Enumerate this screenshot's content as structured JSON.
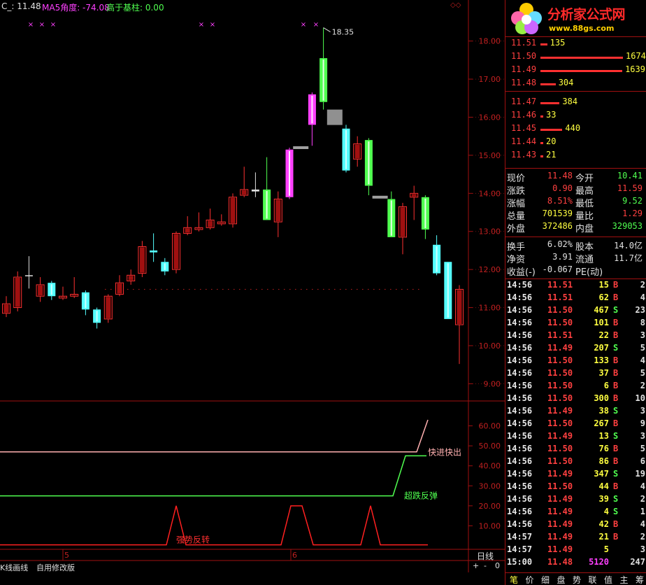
{
  "header": {
    "symbol": "C_: 11.48",
    "ma5_angle": "MA5角度: -74.08",
    "above_base": "高于基柱: 0.00"
  },
  "price_axis": [
    "18.00",
    "17.00",
    "16.00",
    "15.00",
    "14.00",
    "13.00",
    "12.00",
    "11.00",
    "10.00",
    "9.00"
  ],
  "indicator_axis": [
    "60.00",
    "50.00",
    "40.00",
    "30.00",
    "20.00",
    "10.00"
  ],
  "date_labels": [
    "5",
    "6"
  ],
  "peak_label": "18.35",
  "indicator_labels": {
    "fast": "快进快出",
    "oversold": "超跌反弹",
    "strong": "强势反转"
  },
  "logo": {
    "text": "分析家公式网",
    "url": "www.88gs.com"
  },
  "order_book": {
    "asks": [
      {
        "price": "11.51",
        "vol": "135"
      },
      {
        "price": "11.50",
        "vol": "1674"
      },
      {
        "price": "11.49",
        "vol": "1639"
      },
      {
        "price": "11.48",
        "vol": "304"
      }
    ],
    "bids": [
      {
        "price": "11.47",
        "vol": "384"
      },
      {
        "price": "11.46",
        "vol": "33"
      },
      {
        "price": "11.45",
        "vol": "440"
      },
      {
        "price": "11.44",
        "vol": "20"
      },
      {
        "price": "11.43",
        "vol": "21"
      }
    ]
  },
  "quote": [
    {
      "l1": "现价",
      "v1": "11.48",
      "l2": "今开",
      "v2": "10.41"
    },
    {
      "l1": "涨跌",
      "v1": "0.90",
      "l2": "最高",
      "v2": "11.59"
    },
    {
      "l1": "涨幅",
      "v1": "8.51%",
      "l2": "最低",
      "v2": "9.52"
    },
    {
      "l1": "总量",
      "v1": "701539",
      "l2": "量比",
      "v2": "1.29"
    },
    {
      "l1": "外盘",
      "v1": "372486",
      "l2": "内盘",
      "v2": "329053"
    }
  ],
  "fundamentals": [
    {
      "l1": "换手",
      "v1": "6.02%",
      "l2": "股本",
      "v2": "14.0亿"
    },
    {
      "l1": "净资",
      "v1": "3.91",
      "l2": "流通",
      "v2": "11.7亿"
    },
    {
      "l1": "收益(-)",
      "v1": "-0.067",
      "l2": "PE(动)",
      "v2": ""
    }
  ],
  "ticks": [
    {
      "t": "14:56",
      "p": "11.51",
      "v": "15",
      "d": "B",
      "c": "2"
    },
    {
      "t": "14:56",
      "p": "11.51",
      "v": "62",
      "d": "B",
      "c": "4"
    },
    {
      "t": "14:56",
      "p": "11.50",
      "v": "467",
      "d": "S",
      "c": "23"
    },
    {
      "t": "14:56",
      "p": "11.50",
      "v": "101",
      "d": "B",
      "c": "8"
    },
    {
      "t": "14:56",
      "p": "11.51",
      "v": "22",
      "d": "B",
      "c": "3"
    },
    {
      "t": "14:56",
      "p": "11.49",
      "v": "207",
      "d": "S",
      "c": "5"
    },
    {
      "t": "14:56",
      "p": "11.50",
      "v": "133",
      "d": "B",
      "c": "4"
    },
    {
      "t": "14:56",
      "p": "11.50",
      "v": "37",
      "d": "B",
      "c": "5"
    },
    {
      "t": "14:56",
      "p": "11.50",
      "v": "6",
      "d": "B",
      "c": "2"
    },
    {
      "t": "14:56",
      "p": "11.50",
      "v": "300",
      "d": "B",
      "c": "10"
    },
    {
      "t": "14:56",
      "p": "11.49",
      "v": "38",
      "d": "S",
      "c": "3"
    },
    {
      "t": "14:56",
      "p": "11.50",
      "v": "267",
      "d": "B",
      "c": "9"
    },
    {
      "t": "14:56",
      "p": "11.49",
      "v": "13",
      "d": "S",
      "c": "3"
    },
    {
      "t": "14:56",
      "p": "11.50",
      "v": "76",
      "d": "B",
      "c": "5"
    },
    {
      "t": "14:56",
      "p": "11.50",
      "v": "86",
      "d": "B",
      "c": "6"
    },
    {
      "t": "14:56",
      "p": "11.49",
      "v": "347",
      "d": "S",
      "c": "19"
    },
    {
      "t": "14:56",
      "p": "11.50",
      "v": "44",
      "d": "B",
      "c": "4"
    },
    {
      "t": "14:56",
      "p": "11.49",
      "v": "39",
      "d": "S",
      "c": "2"
    },
    {
      "t": "14:56",
      "p": "11.49",
      "v": "4",
      "d": "S",
      "c": "1"
    },
    {
      "t": "14:56",
      "p": "11.49",
      "v": "42",
      "d": "B",
      "c": "4"
    },
    {
      "t": "14:57",
      "p": "11.49",
      "v": "21",
      "d": "B",
      "c": "2"
    },
    {
      "t": "14:57",
      "p": "11.49",
      "v": "5",
      "d": "",
      "c": "3"
    },
    {
      "t": "15:00",
      "p": "11.48",
      "v": "5120",
      "d": "",
      "c": "247"
    }
  ],
  "bottom_tabs": [
    "笔",
    "价",
    "细",
    "盘",
    "势",
    "联",
    "值",
    "主",
    "筹"
  ],
  "left_tabs": [
    "K线画线",
    "自用修改版"
  ],
  "period": "日线",
  "period_btns": [
    "+",
    "-",
    "0"
  ],
  "colors": {
    "up": "#ff3030",
    "down": "#54ffff",
    "green": "#50ff50",
    "yellow": "#ffff40",
    "magenta": "#ff40ff",
    "grid": "#a01010"
  },
  "chart_data": {
    "type": "candlestick",
    "candles": [
      {
        "o": 10.85,
        "c": 11.1,
        "h": 11.3,
        "l": 10.75,
        "k": "up"
      },
      {
        "o": 11.0,
        "c": 11.8,
        "h": 11.95,
        "l": 10.9,
        "k": "up"
      },
      {
        "o": 11.85,
        "c": 11.85,
        "h": 12.35,
        "l": 11.5,
        "k": "flat"
      },
      {
        "o": 11.3,
        "c": 11.6,
        "h": 11.8,
        "l": 11.15,
        "k": "up"
      },
      {
        "o": 11.65,
        "c": 11.3,
        "h": 11.7,
        "l": 11.2,
        "k": "down"
      },
      {
        "o": 11.25,
        "c": 11.3,
        "h": 11.55,
        "l": 11.2,
        "k": "up"
      },
      {
        "o": 11.3,
        "c": 11.35,
        "h": 11.8,
        "l": 11.25,
        "k": "up"
      },
      {
        "o": 11.4,
        "c": 10.95,
        "h": 11.45,
        "l": 10.8,
        "k": "down"
      },
      {
        "o": 10.95,
        "c": 10.6,
        "h": 11.0,
        "l": 10.45,
        "k": "down"
      },
      {
        "o": 10.7,
        "c": 11.3,
        "h": 11.35,
        "l": 10.6,
        "k": "up"
      },
      {
        "o": 11.35,
        "c": 11.65,
        "h": 11.85,
        "l": 11.3,
        "k": "up"
      },
      {
        "o": 11.7,
        "c": 11.85,
        "h": 12.0,
        "l": 11.6,
        "k": "up"
      },
      {
        "o": 11.9,
        "c": 12.6,
        "h": 12.75,
        "l": 11.8,
        "k": "up"
      },
      {
        "o": 12.5,
        "c": 12.45,
        "h": 12.95,
        "l": 12.2,
        "k": "down"
      },
      {
        "o": 12.2,
        "c": 11.95,
        "h": 12.3,
        "l": 11.85,
        "k": "down"
      },
      {
        "o": 12.0,
        "c": 12.95,
        "h": 13.0,
        "l": 11.9,
        "k": "up"
      },
      {
        "o": 12.95,
        "c": 13.1,
        "h": 13.4,
        "l": 12.9,
        "k": "up"
      },
      {
        "o": 13.05,
        "c": 13.1,
        "h": 13.5,
        "l": 13.0,
        "k": "up"
      },
      {
        "o": 13.1,
        "c": 13.3,
        "h": 13.6,
        "l": 13.05,
        "k": "up"
      },
      {
        "o": 13.2,
        "c": 13.25,
        "h": 13.45,
        "l": 13.15,
        "k": "up"
      },
      {
        "o": 13.2,
        "c": 13.9,
        "h": 14.0,
        "l": 13.1,
        "k": "up"
      },
      {
        "o": 13.95,
        "c": 14.1,
        "h": 14.7,
        "l": 13.9,
        "k": "up"
      },
      {
        "o": 14.1,
        "c": 14.05,
        "h": 14.55,
        "l": 13.9,
        "k": "flat"
      },
      {
        "o": 14.1,
        "c": 13.3,
        "h": 14.95,
        "l": 13.3,
        "k": "green"
      },
      {
        "o": 13.25,
        "c": 13.85,
        "h": 14.05,
        "l": 12.85,
        "k": "up"
      },
      {
        "o": 13.9,
        "c": 15.15,
        "h": 15.2,
        "l": 13.85,
        "k": "magenta"
      },
      {
        "o": 15.2,
        "c": 15.2,
        "h": 15.2,
        "l": 15.2,
        "k": "gray"
      },
      {
        "o": 15.8,
        "c": 16.6,
        "h": 16.65,
        "l": 15.25,
        "k": "magenta"
      },
      {
        "o": 16.4,
        "c": 17.55,
        "h": 18.35,
        "l": 16.2,
        "k": "green"
      },
      {
        "o": 16.0,
        "c": 16.0,
        "h": 16.0,
        "l": 16.0,
        "k": "grayblock"
      },
      {
        "o": 15.7,
        "c": 14.6,
        "h": 15.8,
        "l": 14.55,
        "k": "down"
      },
      {
        "o": 14.9,
        "c": 15.3,
        "h": 15.5,
        "l": 14.7,
        "k": "up"
      },
      {
        "o": 15.4,
        "c": 14.2,
        "h": 15.45,
        "l": 13.95,
        "k": "green"
      },
      {
        "o": 13.9,
        "c": 13.9,
        "h": 13.9,
        "l": 13.9,
        "k": "gray"
      },
      {
        "o": 13.85,
        "c": 12.85,
        "h": 14.05,
        "l": 12.85,
        "k": "green"
      },
      {
        "o": 12.85,
        "c": 13.65,
        "h": 13.75,
        "l": 12.4,
        "k": "up"
      },
      {
        "o": 13.9,
        "c": 14.0,
        "h": 14.2,
        "l": 13.3,
        "k": "up"
      },
      {
        "o": 13.9,
        "c": 13.05,
        "h": 13.95,
        "l": 12.8,
        "k": "green"
      },
      {
        "o": 12.65,
        "c": 11.9,
        "h": 12.9,
        "l": 11.85,
        "k": "down"
      },
      {
        "o": 12.2,
        "c": 10.7,
        "h": 12.2,
        "l": 10.7,
        "k": "down"
      },
      {
        "o": 11.48,
        "c": 10.55,
        "h": 11.59,
        "l": 9.52,
        "k": "up"
      }
    ],
    "ylim": [
      8.75,
      18.6
    ],
    "indicator": {
      "ylim": [
        0,
        70
      ],
      "fast_line": 47,
      "oversold_start": 25,
      "oversold_end": 45,
      "fast_end": 63
    }
  }
}
